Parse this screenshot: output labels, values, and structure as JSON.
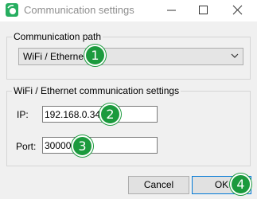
{
  "window": {
    "title": "Communication settings",
    "icon": "app-logo-icon",
    "controls": [
      "minimize-icon",
      "maximize-icon",
      "close-icon"
    ]
  },
  "communication_path": {
    "legend": "Communication path",
    "selected": "WiFi / Ethernet"
  },
  "wifi_settings": {
    "legend": "WiFi / Ethernet communication settings",
    "ip_label": "IP:",
    "ip_value": "192.168.0.34",
    "port_label": "Port:",
    "port_value": "30000"
  },
  "buttons": {
    "cancel_label": "Cancel",
    "ok_label": "OK"
  },
  "badges": [
    "1",
    "2",
    "3",
    "4"
  ],
  "colors": {
    "badge": "#1b9a3d",
    "app_icon": "#27ae60",
    "ok_border": "#0078d7"
  }
}
